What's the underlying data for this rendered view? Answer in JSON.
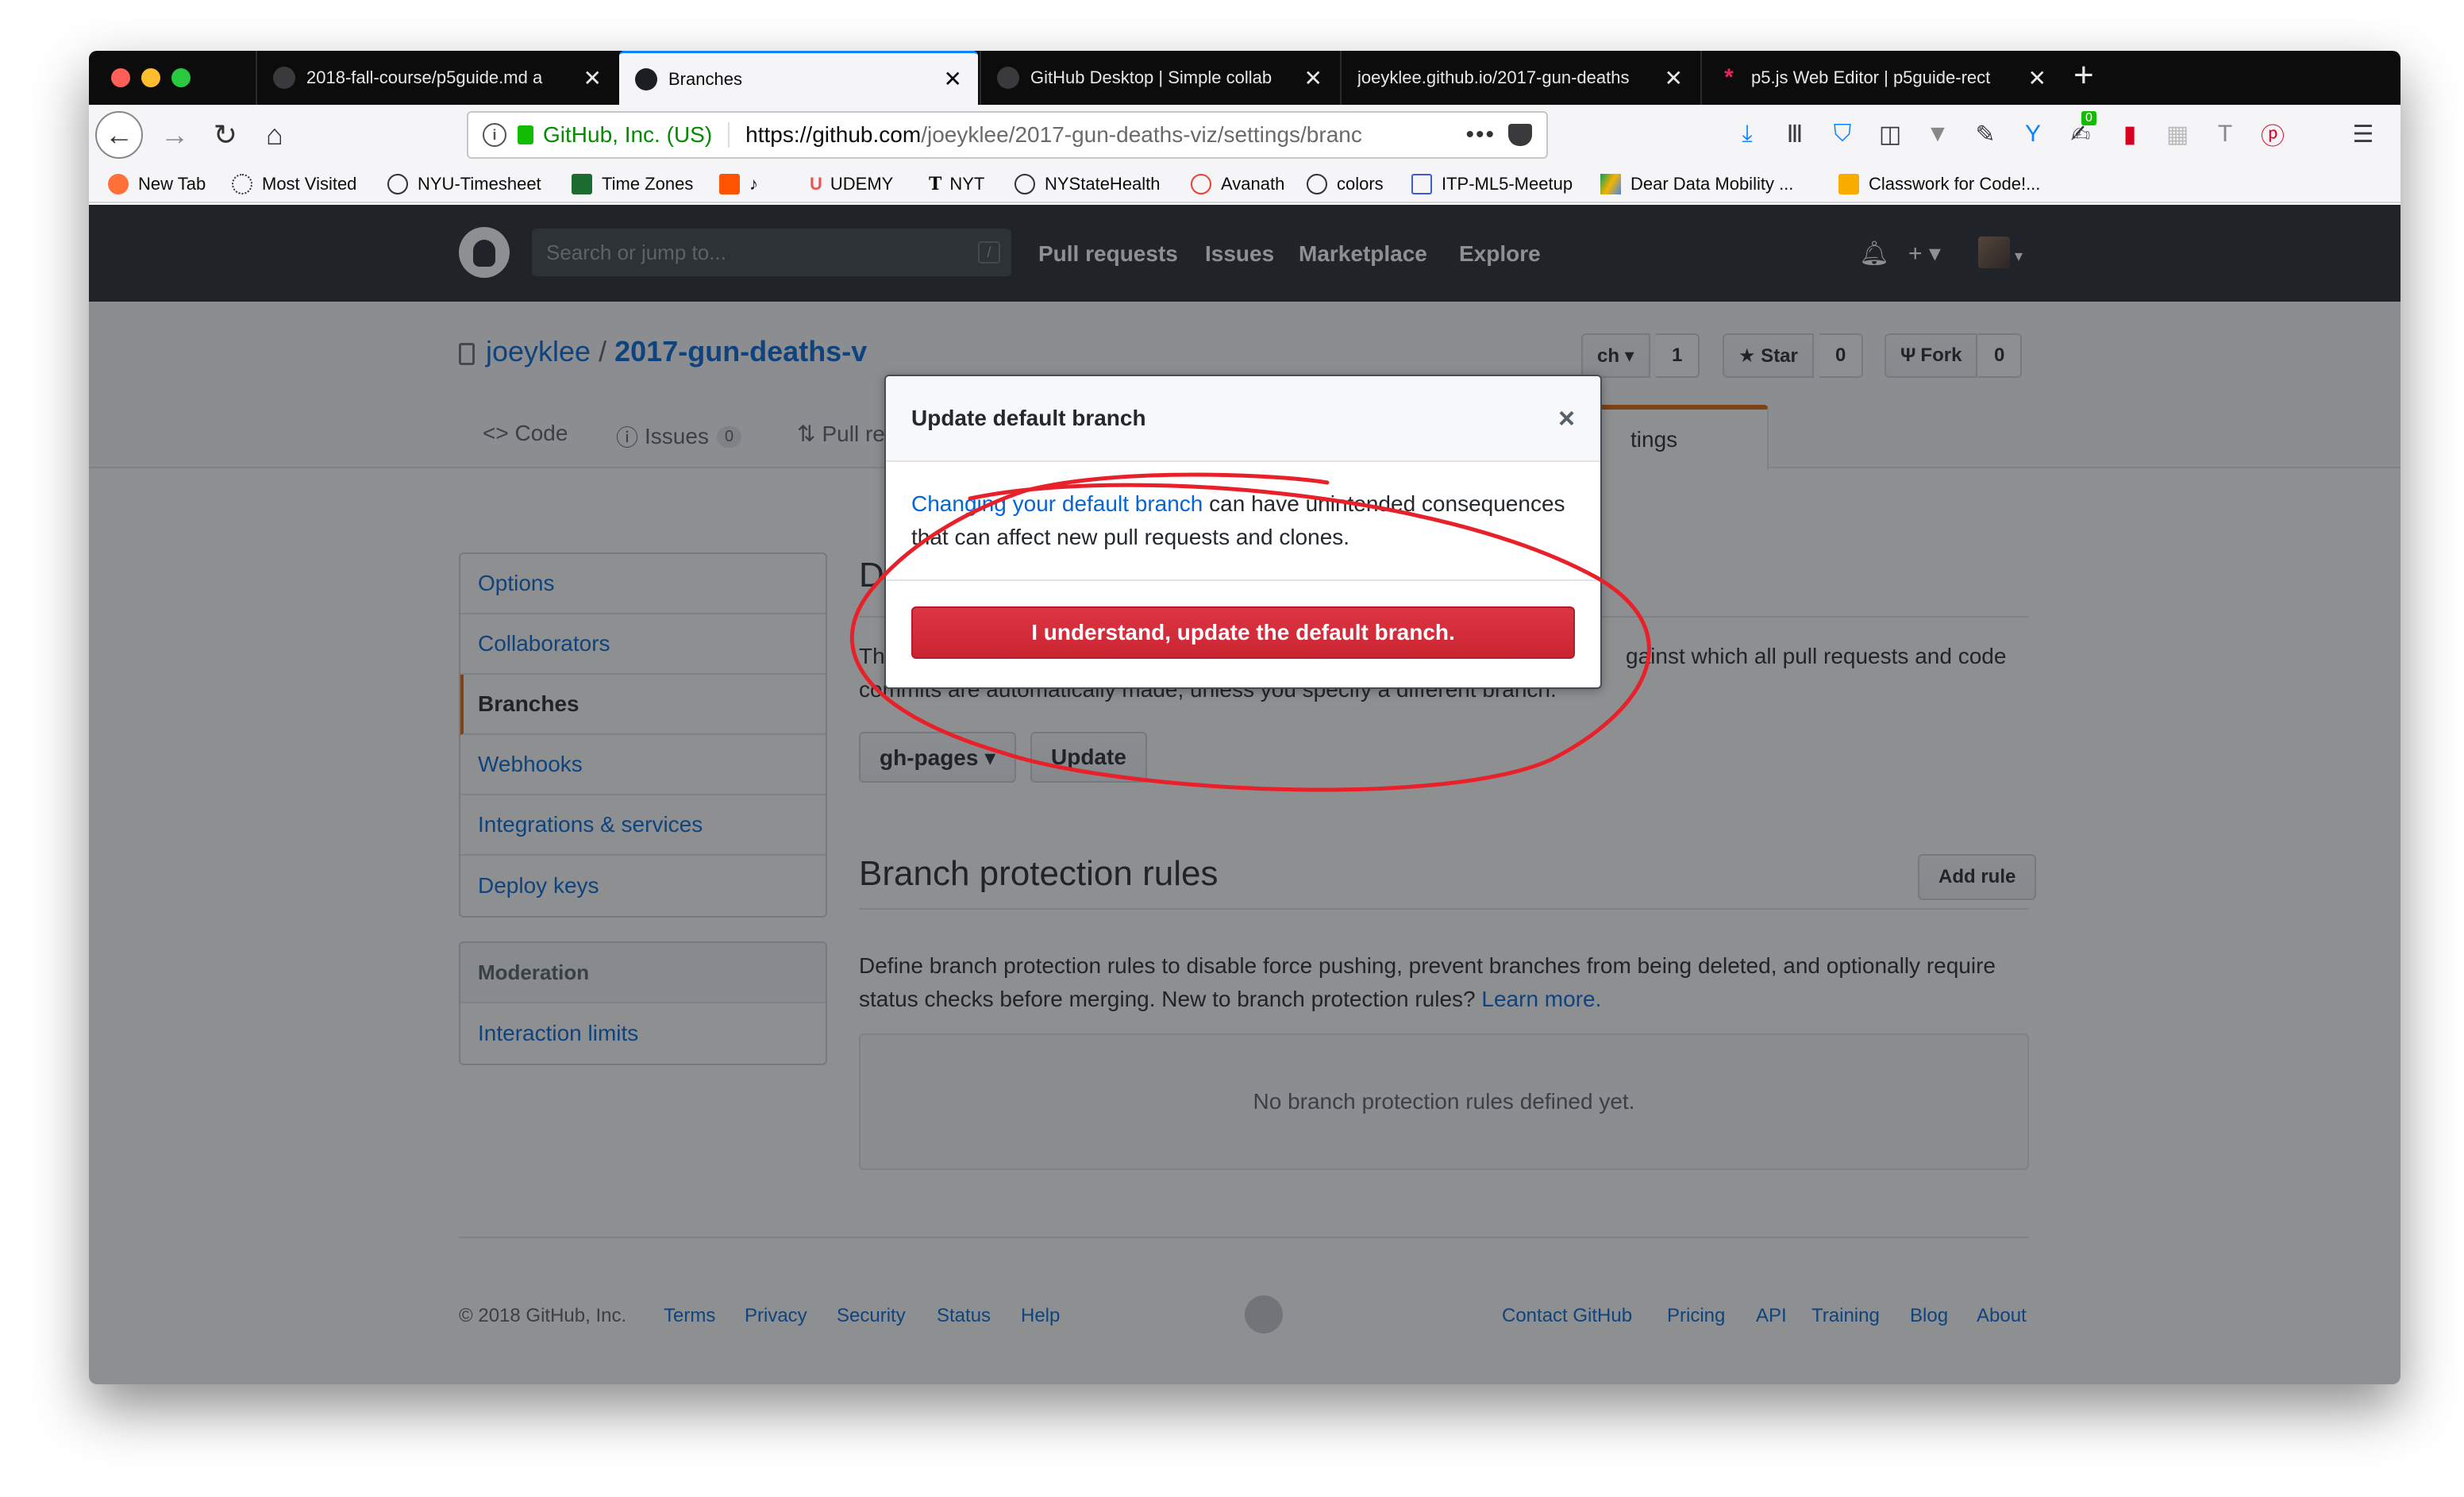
{
  "browser": {
    "tabs": [
      {
        "title": "2018-fall-course/p5guide.md a",
        "active": false
      },
      {
        "title": "Branches",
        "active": true
      },
      {
        "title": "GitHub Desktop | Simple collab",
        "active": false
      },
      {
        "title": "joeyklee.github.io/2017-gun-deaths",
        "active": false
      },
      {
        "title": "p5.js Web Editor | p5guide-rect",
        "active": false
      }
    ],
    "close_glyph": "✕",
    "new_tab_glyph": "+",
    "url_company": "GitHub, Inc. (US)",
    "url_host": "https://github.com",
    "url_path": "/joeyklee/2017-gun-deaths-viz/settings/branc",
    "url_dots": "•••",
    "badge_count": "0",
    "bookmarks": [
      "New Tab",
      "Most Visited",
      "NYU-Timesheet",
      "Time Zones",
      "UDEMY",
      "NYT",
      "NYStateHealth",
      "Avanath",
      "colors",
      "ITP-ML5-Meetup",
      "Dear Data Mobility ...",
      "Classwork for Code!..."
    ]
  },
  "github": {
    "search_placeholder": "Search or jump to...",
    "search_slash": "/",
    "nav": [
      "Pull requests",
      "Issues",
      "Marketplace",
      "Explore"
    ],
    "header_plus": "+ ▾",
    "repo_owner": "joeyklee",
    "repo_sep": "/",
    "repo_name": "2017-gun-deaths-v",
    "watch_label": "ch ▾",
    "watch_count": "1",
    "star_label": "★ Star",
    "star_count": "0",
    "fork_label": "Fork",
    "fork_count": "0",
    "tabs": {
      "code": "<> Code",
      "issues": "Issues",
      "issues_count": "0",
      "pulls": "Pull re",
      "settings": "tings"
    },
    "menu": [
      "Options",
      "Collaborators",
      "Branches",
      "Webhooks",
      "Integrations & services",
      "Deploy keys"
    ],
    "menu_selected": "Branches",
    "moderation_heading": "Moderation",
    "moderation_items": [
      "Interaction limits"
    ],
    "default_branch_heading": "D",
    "default_branch_text_start": "Th",
    "default_branch_text_end": "gainst which all pull requests and code",
    "default_branch_text_line2": "commits are automatically made, unless you specify a different branch.",
    "branch_select": "gh-pages ▾",
    "update_button": "Update",
    "protection_heading": "Branch protection rules",
    "add_rule_button": "Add rule",
    "protection_text": "Define branch protection rules to disable force pushing, prevent branches from being deleted, and optionally require status checks before merging. New to branch protection rules?",
    "learn_more": "Learn more.",
    "no_rules": "No branch protection rules defined yet.",
    "footer_copyright": "© 2018 GitHub, Inc.",
    "footer_left": [
      "Terms",
      "Privacy",
      "Security",
      "Status",
      "Help"
    ],
    "footer_right": [
      "Contact GitHub",
      "Pricing",
      "API",
      "Training",
      "Blog",
      "About"
    ]
  },
  "dialog": {
    "title": "Update default branch",
    "close": "×",
    "link_text": "Changing your default branch",
    "body_text": " can have unintended consequences that can affect new pull requests and clones.",
    "confirm_button": "I understand, update the default branch."
  },
  "colors": {
    "annotation": "#e8202a",
    "danger": "#cb2431",
    "link": "#0366d6",
    "header": "#24292e"
  }
}
